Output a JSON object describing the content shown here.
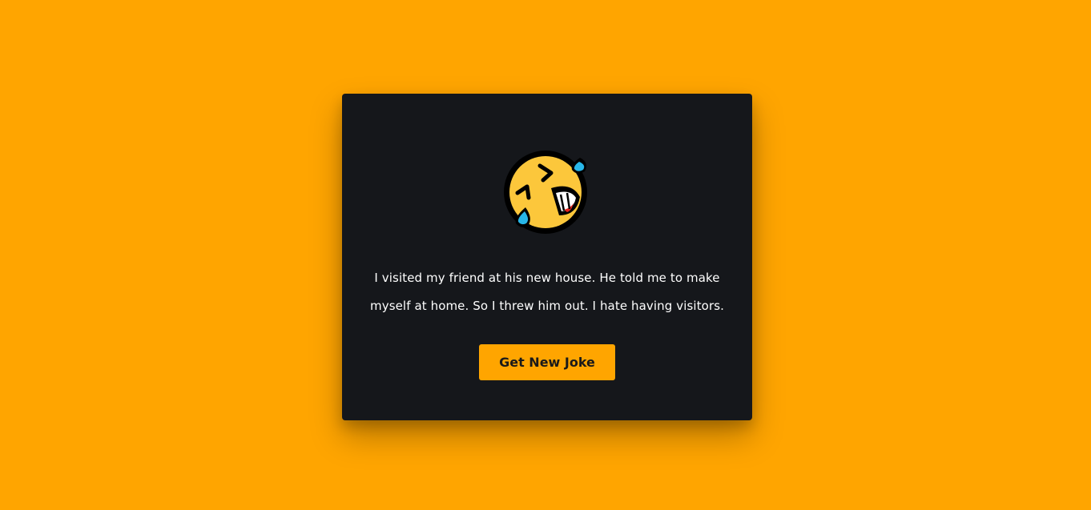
{
  "joke": {
    "icon": "rolling-on-floor-laughing-emoji-icon",
    "text": "I visited my friend at his new house. He told me to make myself at home. So I threw him out. I hate having visitors."
  },
  "button": {
    "label": "Get New Joke"
  },
  "colors": {
    "background": "#FFA500",
    "card": "#15171b",
    "button": "#FFA500",
    "button_text": "#1a1a1a",
    "text": "#ffffff"
  }
}
